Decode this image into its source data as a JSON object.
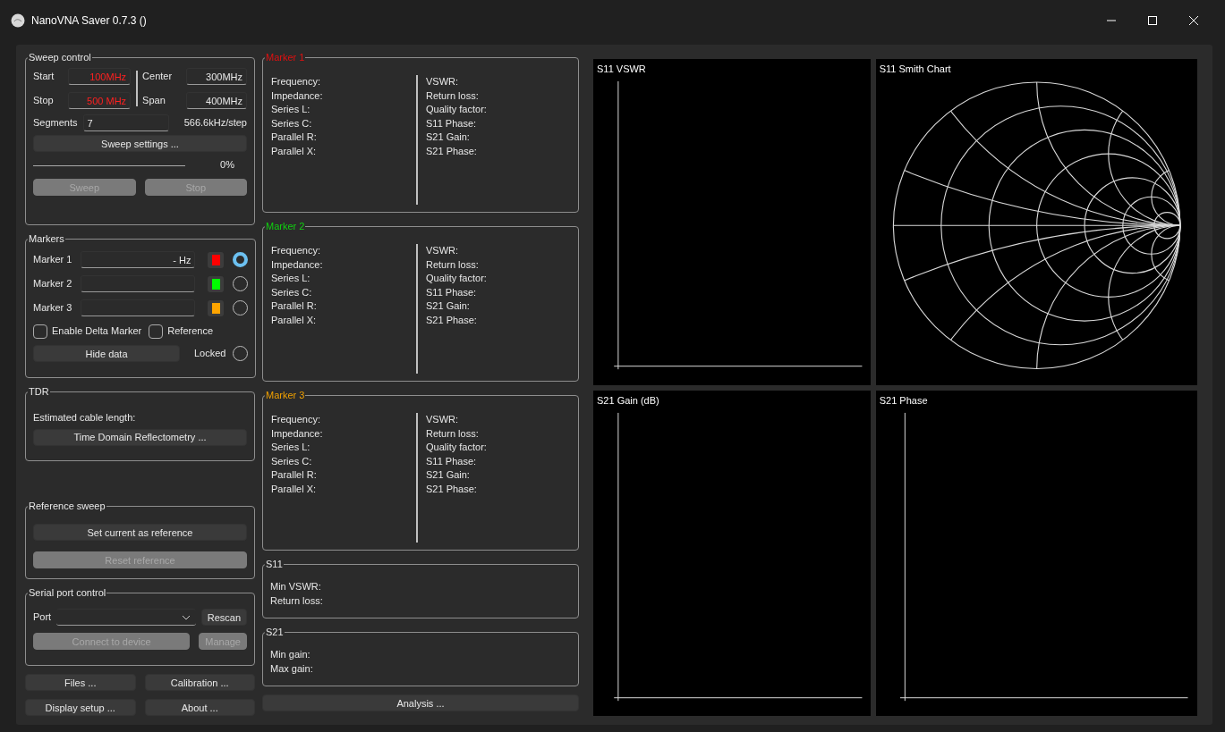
{
  "window": {
    "title": "NanoVNA Saver 0.7.3 ()"
  },
  "sweep_control": {
    "title": "Sweep control",
    "fields": [
      {
        "label": "Start",
        "value": "100MHz",
        "highlighted": true
      },
      {
        "label": "Center",
        "value": "300MHz",
        "highlighted": false
      },
      {
        "label": "Stop",
        "value": "500 MHz",
        "highlighted": true
      },
      {
        "label": "Span",
        "value": "400MHz",
        "highlighted": false
      }
    ],
    "segments": {
      "label": "Segments",
      "value": "7"
    },
    "step": "566.6kHz/step",
    "settings_button": "Sweep settings ...",
    "progress": {
      "level": 0,
      "reading": "0%"
    },
    "buttons": [
      {
        "label": "Sweep",
        "disabled": true
      },
      {
        "label": "Stop",
        "disabled": true
      }
    ]
  },
  "markers": {
    "title": "Markers",
    "items": [
      {
        "label": "Marker 1",
        "value": "- Hz",
        "color": "#ff0000",
        "selected": true
      },
      {
        "label": "Marker 2",
        "color": "#00ff00",
        "selected": false
      },
      {
        "label": "Marker 3",
        "color": "#ffa500",
        "selected": false
      }
    ],
    "checkboxes": [
      {
        "label": "Enable Delta Marker",
        "checked": false
      },
      {
        "label": "Reference",
        "checked": false
      }
    ],
    "hide_button": "Hide data",
    "locked": {
      "label": "Locked",
      "checked": false
    }
  },
  "tdr": {
    "title": "TDR",
    "label": "Estimated cable length:",
    "button": "Time Domain Reflectometry ..."
  },
  "reference_sweep": {
    "title": "Reference sweep",
    "buttons": [
      {
        "label": "Set current as reference",
        "disabled": false
      },
      {
        "label": "Reset reference",
        "disabled": true
      }
    ]
  },
  "serial_port": {
    "title": "Serial port control",
    "port_label": "Port",
    "rescan": {
      "label": "Rescan",
      "disabled": false
    },
    "connect": {
      "label": "Connect to device",
      "disabled": true
    },
    "manage": {
      "label": "Manage",
      "disabled": true
    }
  },
  "bottom_buttons": [
    "Files ...",
    "Calibration ...",
    "Display setup ...",
    "About ..."
  ],
  "marker_panels": [
    {
      "title": "Marker 1",
      "color": "#e01010",
      "left": [
        "Frequency:",
        "Impedance:",
        "Series L:",
        "Series C:",
        "Parallel R:",
        "Parallel X:"
      ],
      "right": [
        "VSWR:",
        "Return loss:",
        "Quality factor:",
        "S11 Phase:",
        "S21 Gain:",
        "S21 Phase:"
      ]
    },
    {
      "title": "Marker 2",
      "color": "#10d010",
      "left": [
        "Frequency:",
        "Impedance:",
        "Series L:",
        "Series C:",
        "Parallel R:",
        "Parallel X:"
      ],
      "right": [
        "VSWR:",
        "Return loss:",
        "Quality factor:",
        "S11 Phase:",
        "S21 Gain:",
        "S21 Phase:"
      ]
    },
    {
      "title": "Marker 3",
      "color": "#f0a000",
      "left": [
        "Frequency:",
        "Impedance:",
        "Series L:",
        "Series C:",
        "Parallel R:",
        "Parallel X:"
      ],
      "right": [
        "VSWR:",
        "Return loss:",
        "Quality factor:",
        "S11 Phase:",
        "S21 Gain:",
        "S21 Phase:"
      ]
    }
  ],
  "s11": {
    "title": "S11",
    "fields": [
      "Min VSWR:",
      "Return loss:"
    ]
  },
  "s21": {
    "title": "S21",
    "fields": [
      "Min gain:",
      "Max gain:"
    ]
  },
  "analysis_button": "Analysis ...",
  "charts": [
    {
      "title": "S11 VSWR",
      "kind": "axes"
    },
    {
      "title": "S11 Smith Chart",
      "kind": "smith"
    },
    {
      "title": "S21 Gain (dB)",
      "kind": "axes"
    },
    {
      "title": "S21 Phase",
      "kind": "axes"
    }
  ]
}
